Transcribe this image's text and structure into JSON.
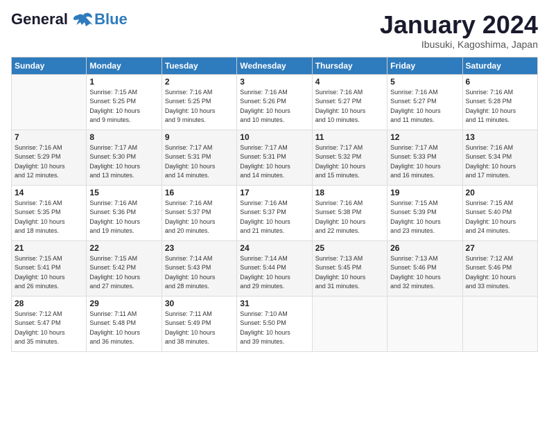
{
  "header": {
    "logo_line1": "General",
    "logo_line2": "Blue",
    "month_title": "January 2024",
    "location": "Ibusuki, Kagoshima, Japan"
  },
  "calendar": {
    "days_of_week": [
      "Sunday",
      "Monday",
      "Tuesday",
      "Wednesday",
      "Thursday",
      "Friday",
      "Saturday"
    ],
    "weeks": [
      [
        {
          "day": "",
          "info": ""
        },
        {
          "day": "1",
          "info": "Sunrise: 7:15 AM\nSunset: 5:25 PM\nDaylight: 10 hours\nand 9 minutes."
        },
        {
          "day": "2",
          "info": "Sunrise: 7:16 AM\nSunset: 5:25 PM\nDaylight: 10 hours\nand 9 minutes."
        },
        {
          "day": "3",
          "info": "Sunrise: 7:16 AM\nSunset: 5:26 PM\nDaylight: 10 hours\nand 10 minutes."
        },
        {
          "day": "4",
          "info": "Sunrise: 7:16 AM\nSunset: 5:27 PM\nDaylight: 10 hours\nand 10 minutes."
        },
        {
          "day": "5",
          "info": "Sunrise: 7:16 AM\nSunset: 5:27 PM\nDaylight: 10 hours\nand 11 minutes."
        },
        {
          "day": "6",
          "info": "Sunrise: 7:16 AM\nSunset: 5:28 PM\nDaylight: 10 hours\nand 11 minutes."
        }
      ],
      [
        {
          "day": "7",
          "info": "Sunrise: 7:16 AM\nSunset: 5:29 PM\nDaylight: 10 hours\nand 12 minutes."
        },
        {
          "day": "8",
          "info": "Sunrise: 7:17 AM\nSunset: 5:30 PM\nDaylight: 10 hours\nand 13 minutes."
        },
        {
          "day": "9",
          "info": "Sunrise: 7:17 AM\nSunset: 5:31 PM\nDaylight: 10 hours\nand 14 minutes."
        },
        {
          "day": "10",
          "info": "Sunrise: 7:17 AM\nSunset: 5:31 PM\nDaylight: 10 hours\nand 14 minutes."
        },
        {
          "day": "11",
          "info": "Sunrise: 7:17 AM\nSunset: 5:32 PM\nDaylight: 10 hours\nand 15 minutes."
        },
        {
          "day": "12",
          "info": "Sunrise: 7:17 AM\nSunset: 5:33 PM\nDaylight: 10 hours\nand 16 minutes."
        },
        {
          "day": "13",
          "info": "Sunrise: 7:16 AM\nSunset: 5:34 PM\nDaylight: 10 hours\nand 17 minutes."
        }
      ],
      [
        {
          "day": "14",
          "info": "Sunrise: 7:16 AM\nSunset: 5:35 PM\nDaylight: 10 hours\nand 18 minutes."
        },
        {
          "day": "15",
          "info": "Sunrise: 7:16 AM\nSunset: 5:36 PM\nDaylight: 10 hours\nand 19 minutes."
        },
        {
          "day": "16",
          "info": "Sunrise: 7:16 AM\nSunset: 5:37 PM\nDaylight: 10 hours\nand 20 minutes."
        },
        {
          "day": "17",
          "info": "Sunrise: 7:16 AM\nSunset: 5:37 PM\nDaylight: 10 hours\nand 21 minutes."
        },
        {
          "day": "18",
          "info": "Sunrise: 7:16 AM\nSunset: 5:38 PM\nDaylight: 10 hours\nand 22 minutes."
        },
        {
          "day": "19",
          "info": "Sunrise: 7:15 AM\nSunset: 5:39 PM\nDaylight: 10 hours\nand 23 minutes."
        },
        {
          "day": "20",
          "info": "Sunrise: 7:15 AM\nSunset: 5:40 PM\nDaylight: 10 hours\nand 24 minutes."
        }
      ],
      [
        {
          "day": "21",
          "info": "Sunrise: 7:15 AM\nSunset: 5:41 PM\nDaylight: 10 hours\nand 26 minutes."
        },
        {
          "day": "22",
          "info": "Sunrise: 7:15 AM\nSunset: 5:42 PM\nDaylight: 10 hours\nand 27 minutes."
        },
        {
          "day": "23",
          "info": "Sunrise: 7:14 AM\nSunset: 5:43 PM\nDaylight: 10 hours\nand 28 minutes."
        },
        {
          "day": "24",
          "info": "Sunrise: 7:14 AM\nSunset: 5:44 PM\nDaylight: 10 hours\nand 29 minutes."
        },
        {
          "day": "25",
          "info": "Sunrise: 7:13 AM\nSunset: 5:45 PM\nDaylight: 10 hours\nand 31 minutes."
        },
        {
          "day": "26",
          "info": "Sunrise: 7:13 AM\nSunset: 5:46 PM\nDaylight: 10 hours\nand 32 minutes."
        },
        {
          "day": "27",
          "info": "Sunrise: 7:12 AM\nSunset: 5:46 PM\nDaylight: 10 hours\nand 33 minutes."
        }
      ],
      [
        {
          "day": "28",
          "info": "Sunrise: 7:12 AM\nSunset: 5:47 PM\nDaylight: 10 hours\nand 35 minutes."
        },
        {
          "day": "29",
          "info": "Sunrise: 7:11 AM\nSunset: 5:48 PM\nDaylight: 10 hours\nand 36 minutes."
        },
        {
          "day": "30",
          "info": "Sunrise: 7:11 AM\nSunset: 5:49 PM\nDaylight: 10 hours\nand 38 minutes."
        },
        {
          "day": "31",
          "info": "Sunrise: 7:10 AM\nSunset: 5:50 PM\nDaylight: 10 hours\nand 39 minutes."
        },
        {
          "day": "",
          "info": ""
        },
        {
          "day": "",
          "info": ""
        },
        {
          "day": "",
          "info": ""
        }
      ]
    ]
  }
}
